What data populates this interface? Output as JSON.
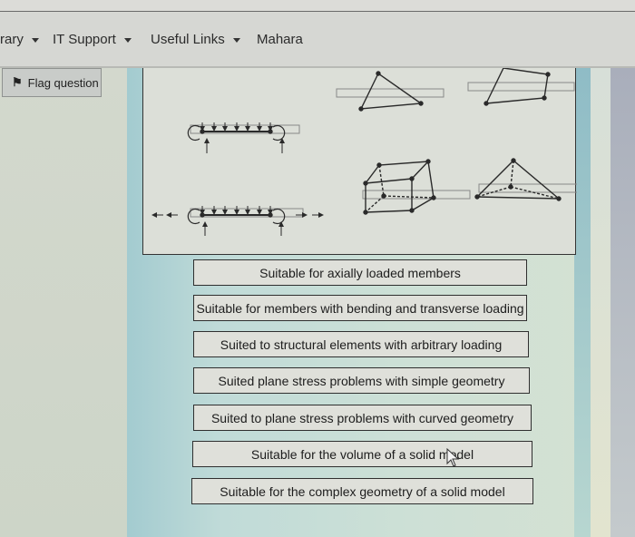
{
  "navbar": {
    "items": [
      {
        "label": "rary",
        "has_dropdown": true
      },
      {
        "label": "IT Support",
        "has_dropdown": true
      },
      {
        "label": "Useful Links",
        "has_dropdown": true
      },
      {
        "label": "Mahara",
        "has_dropdown": false
      }
    ]
  },
  "question": {
    "flag_label": "Flag question",
    "flag_icon": "flag-icon"
  },
  "diagram": {
    "elements": [
      "beam-element",
      "frame-element",
      "triangular-plane-element",
      "quadrilateral-plane-element",
      "hexahedral-solid-element",
      "tetrahedral-solid-element"
    ]
  },
  "choices": [
    "Suitable for axially loaded members",
    "Suitable for members with bending and transverse loading",
    "Suited to structural elements with arbitrary loading",
    "Suited plane stress problems with simple geometry",
    "Suited to plane stress problems with curved geometry",
    "Suitable for the volume of a solid model",
    "Suitable for the complex geometry of a solid model"
  ],
  "colors": {
    "drop_box_border": "#7a7a7a",
    "line": "#2a2a2a"
  }
}
